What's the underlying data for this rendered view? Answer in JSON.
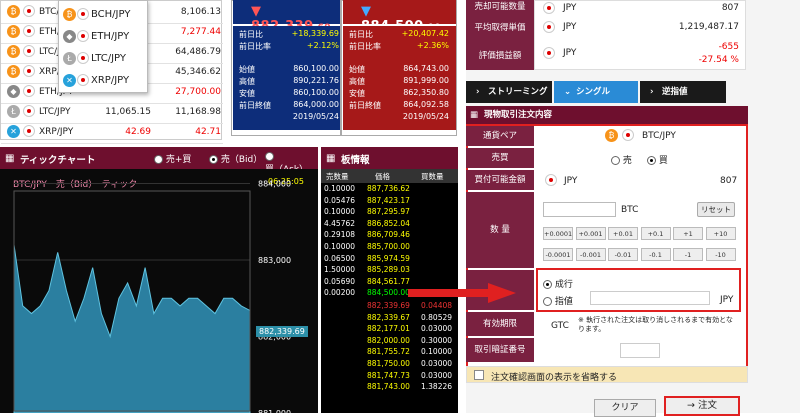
{
  "coins": [
    {
      "name": "BTC/JPY",
      "v1": "",
      "v2": "8,106.13",
      "v1c": "#e00",
      "v2c": "#222",
      "color": "#f7931a",
      "sym": "₿",
      "flag": "gb"
    },
    {
      "name": "ETH/JPY",
      "v1": "",
      "v2": "7,277.44",
      "v1c": "#e00",
      "v2c": "#e00",
      "color": "#f7931a",
      "sym": "₿",
      "flag": "eu"
    },
    {
      "name": "LTC/JPY",
      "v1": "",
      "v2": "64,486.79",
      "v1c": "#222",
      "v2c": "#222",
      "color": "#f7931a",
      "sym": "₿",
      "flag": "hk"
    },
    {
      "name": "XRP/JPY",
      "v1": "",
      "v2": "45,346.62",
      "v1c": "#222",
      "v2c": "#222",
      "color": "#f7931a",
      "sym": "₿",
      "flag": "jp"
    },
    {
      "name": "ETH/JPY",
      "v1": "",
      "v2": "27,700.00",
      "v1c": "#e00",
      "v2c": "#e00",
      "color": "#888",
      "sym": "◆",
      "flag": "jp"
    },
    {
      "name": "LTC/JPY",
      "v1": "11,065.15",
      "v2": "11,168.98",
      "v1c": "#222",
      "v2c": "#222",
      "color": "#aaa",
      "sym": "Ł",
      "flag": "jp"
    },
    {
      "name": "XRP/JPY",
      "v1": "42.69",
      "v2": "42.71",
      "v1c": "#e00",
      "v2c": "#e00",
      "color": "#27a2db",
      "sym": "✕",
      "flag": "jp"
    }
  ],
  "dropdown": [
    "BCH/JPY",
    "ETH/JPY",
    "LTC/JPY",
    "XRP/JPY"
  ],
  "bid": {
    "main": "882,339",
    "dec": ".69",
    "prev_label": "前日比",
    "prev": "+18,339.69",
    "ratio_label": "前日比率",
    "ratio": "+2.12%",
    "open_label": "始値",
    "open": "860,100.00",
    "high_label": "高値",
    "high": "890,221.76",
    "low_label": "安値",
    "low": "860,100.00",
    "close_label": "前日終値",
    "close": "864,000.00",
    "date": "2019/05/24"
  },
  "ask": {
    "main": "884,500",
    "dec": ".00",
    "prev_label": "前日比",
    "prev": "+20,407.42",
    "ratio_label": "前日比率",
    "ratio": "+2.36%",
    "open_label": "始値",
    "open": "864,743.00",
    "high_label": "高値",
    "high": "891,999.00",
    "low_label": "安値",
    "low": "862,350.80",
    "close_label": "前日終値",
    "close": "864,092.58",
    "date": "2019/05/24"
  },
  "chart": {
    "title": "ティックチャート",
    "opt1": "売+買",
    "opt2": "売（Bid）",
    "opt3": "買（Ask）",
    "label": "BTC/JPY　売（Bid）　ティック",
    "time": "06:25:05",
    "current": "882,339.69",
    "yticks": [
      "884,000",
      "883,000",
      "882,000",
      "881,000"
    ]
  },
  "chart_data": {
    "type": "area",
    "series": [
      {
        "values": [
          883.2,
          882.4,
          882.3,
          882.4,
          882.6,
          883.1,
          882.6,
          882.2,
          882.5,
          882.9,
          882.3,
          882.0,
          882.5,
          882.7,
          882.4,
          882.9,
          882.3,
          882.5,
          882.5,
          882.4,
          882.5,
          882.5,
          882.4,
          882.3,
          882.5,
          882.5,
          882.4,
          882.34
        ]
      }
    ],
    "yticks": [
      884000,
      883000,
      882000,
      881000
    ],
    "ylim": [
      881000,
      885000
    ]
  },
  "book": {
    "title": "板情報",
    "h1": "売数量",
    "h2": "価格",
    "h3": "買数量",
    "asks": [
      [
        "0.10000",
        "887,736.62"
      ],
      [
        "0.05476",
        "887,423.17"
      ],
      [
        "0.10000",
        "887,295.97"
      ],
      [
        "4.45762",
        "886,852.04"
      ],
      [
        "0.29108",
        "886,709.46"
      ],
      [
        "0.10000",
        "885,700.00"
      ],
      [
        "0.06500",
        "885,974.59"
      ],
      [
        "1.50000",
        "885,289.03"
      ],
      [
        "0.05690",
        "884,561.77"
      ],
      [
        "0.00200",
        "884,500.00"
      ]
    ],
    "bids": [
      [
        "882,339.69",
        "0.04408"
      ],
      [
        "882,339.67",
        "0.80529"
      ],
      [
        "882,177.01",
        "0.03000"
      ],
      [
        "882,000.00",
        "0.30000"
      ],
      [
        "881,755.72",
        "0.10000"
      ],
      [
        "881,750.00",
        "0.03000"
      ],
      [
        "881,747.73",
        "0.03000"
      ],
      [
        "881,743.00",
        "1.38226"
      ]
    ]
  },
  "info": {
    "l1": "売却可能数量",
    "v1": "807",
    "l2": "平均取得単価",
    "v2": "1,219,487.17",
    "l3": "評価損益額",
    "v3": "-655",
    "v3b": "-27.54 %",
    "ccy": "JPY"
  },
  "tabs": {
    "t1": "ストリーミング",
    "t2": "シングル",
    "t3": "逆指値"
  },
  "order": {
    "title": "現物取引注文内容",
    "pair_label": "通貨ペア",
    "pair": "BTC/JPY",
    "side_label": "売買",
    "sell": "売",
    "buy": "買",
    "avail_label": "買付可能金額",
    "avail_ccy": "JPY",
    "avail": "807",
    "qty_label": "数 量",
    "qty_unit": "BTC",
    "reset": "リセット",
    "steps_plus": [
      "+0.0001",
      "+0.001",
      "+0.01",
      "+0.1",
      "+1",
      "+10"
    ],
    "steps_minus": [
      "-0.0001",
      "-0.001",
      "-0.01",
      "-0.1",
      "-1",
      "-10"
    ],
    "market": "成行",
    "limit": "指値",
    "limit_ccy": "JPY",
    "expiry_label": "有効期限",
    "expiry": "GTC",
    "expiry_note": "※ 執行された注文は取り消しされるまで有効となります。",
    "pin_label": "取引暗証番号",
    "skip": "注文確認画面の表示を省略する",
    "clear": "クリア",
    "submit": "注文"
  }
}
